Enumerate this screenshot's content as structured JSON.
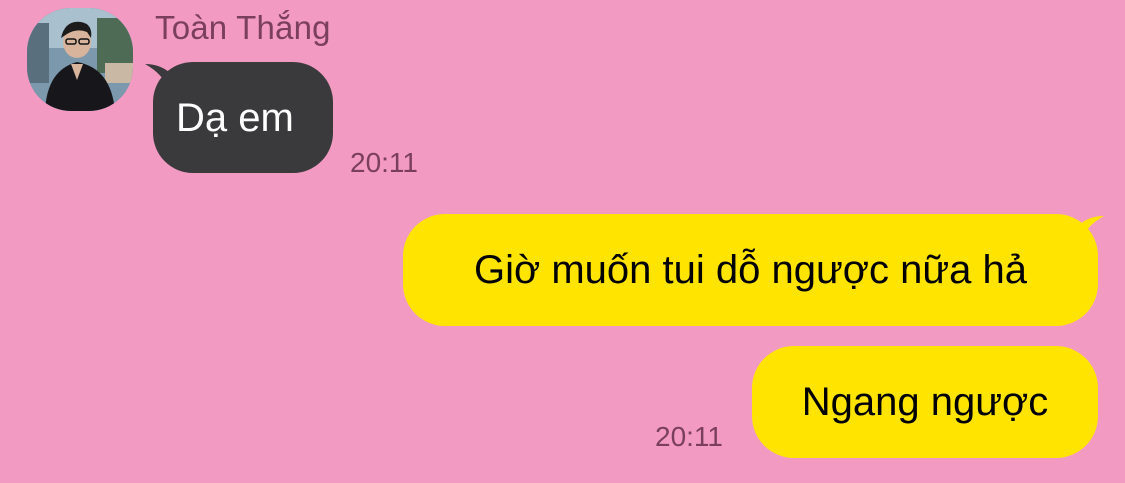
{
  "conversation": {
    "sender": {
      "name": "Toàn Thắng",
      "avatar": "user-photo-avatar"
    },
    "incoming": {
      "text": "Dạ em",
      "time": "20:11",
      "bubble_color": "#3a3a3c"
    },
    "outgoing": [
      {
        "text": "Giờ muốn tui dỗ ngược nữa hả"
      },
      {
        "text": "Ngang ngược",
        "time": "20:11"
      }
    ],
    "outgoing_bubble_color": "#ffe400",
    "background_color": "#f39ac3"
  }
}
